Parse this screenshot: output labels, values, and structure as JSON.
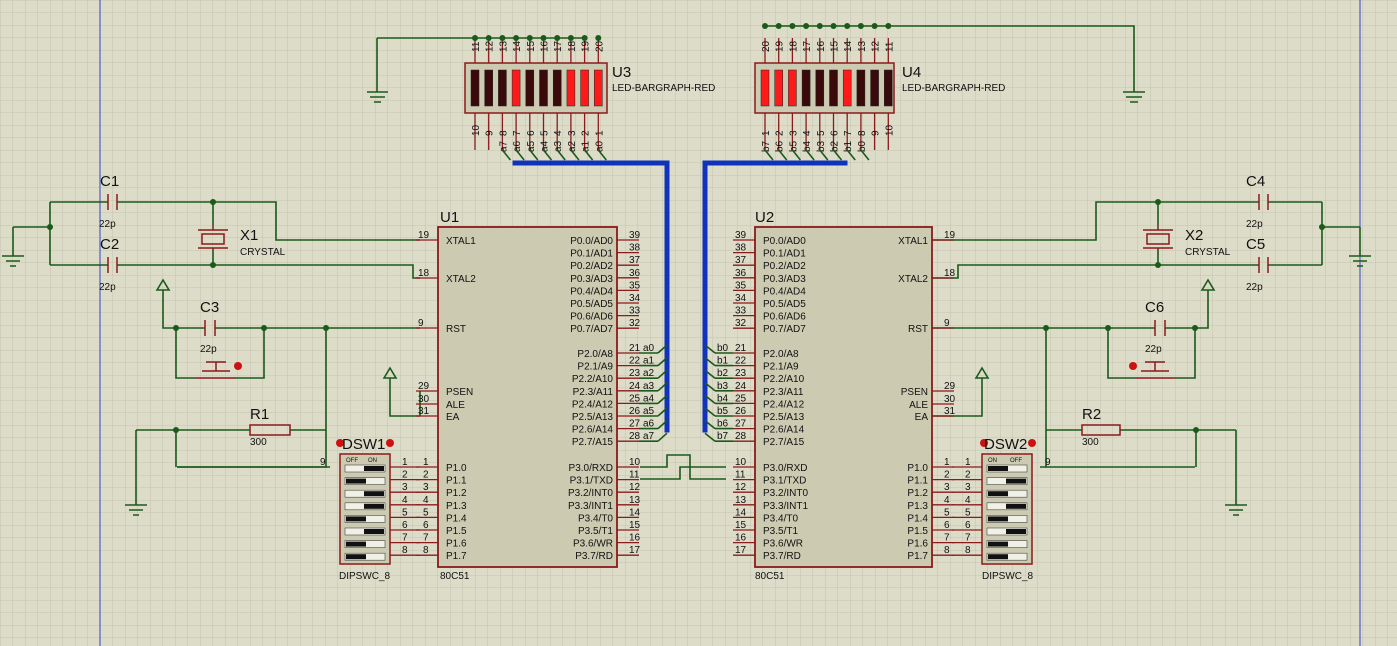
{
  "mcu": {
    "u1": {
      "ref": "U1",
      "type": "80C51"
    },
    "u2": {
      "ref": "U2",
      "type": "80C51"
    },
    "xtal1": "XTAL1",
    "xtal2": "XTAL2",
    "rst": "RST",
    "psen": "PSEN",
    "ale": "ALE",
    "ea": "EA",
    "p0": [
      [
        "P0.0/AD0",
        "39"
      ],
      [
        "P0.1/AD1",
        "38"
      ],
      [
        "P0.2/AD2",
        "37"
      ],
      [
        "P0.3/AD3",
        "36"
      ],
      [
        "P0.4/AD4",
        "35"
      ],
      [
        "P0.5/AD5",
        "34"
      ],
      [
        "P0.6/AD6",
        "33"
      ],
      [
        "P0.7/AD7",
        "32"
      ]
    ],
    "p2": [
      [
        "P2.0/A8",
        "21"
      ],
      [
        "P2.1/A9",
        "22"
      ],
      [
        "P2.2/A10",
        "23"
      ],
      [
        "P2.3/A11",
        "24"
      ],
      [
        "P2.4/A12",
        "25"
      ],
      [
        "P2.5/A13",
        "26"
      ],
      [
        "P2.6/A14",
        "27"
      ],
      [
        "P2.7/A15",
        "28"
      ]
    ],
    "p3": [
      [
        "P3.0/RXD",
        "10"
      ],
      [
        "P3.1/TXD",
        "11"
      ],
      [
        "P3.2/INT0",
        "12"
      ],
      [
        "P3.3/INT1",
        "13"
      ],
      [
        "P3.4/T0",
        "14"
      ],
      [
        "P3.5/T1",
        "15"
      ],
      [
        "P3.6/WR",
        "16"
      ],
      [
        "P3.7/RD",
        "17"
      ]
    ],
    "p1": [
      [
        "P1.0",
        "1"
      ],
      [
        "P1.1",
        "2"
      ],
      [
        "P1.2",
        "3"
      ],
      [
        "P1.3",
        "4"
      ],
      [
        "P1.4",
        "5"
      ],
      [
        "P1.5",
        "6"
      ],
      [
        "P1.6",
        "7"
      ],
      [
        "P1.7",
        "8"
      ]
    ],
    "pins": {
      "xtal1": "19",
      "xtal2": "18",
      "rst": "9",
      "psen": "29",
      "ale": "30",
      "ea": "31"
    }
  },
  "bargraph": {
    "u3": {
      "ref": "U3",
      "type": "LED-BARGRAPH-RED"
    },
    "u4": {
      "ref": "U4",
      "type": "LED-BARGRAPH-RED"
    },
    "top_pins": [
      "11",
      "12",
      "13",
      "14",
      "15",
      "16",
      "17",
      "18",
      "19",
      "20"
    ],
    "bottom_pins": [
      "10",
      "9",
      "8",
      "7",
      "6",
      "5",
      "4",
      "3",
      "2",
      "1"
    ],
    "u3_lit": [
      false,
      false,
      false,
      true,
      false,
      false,
      false,
      true,
      true,
      true
    ],
    "u4_lit": [
      true,
      true,
      true,
      false,
      false,
      false,
      true,
      false,
      false,
      false
    ]
  },
  "nets": {
    "a": [
      "a7",
      "a6",
      "a5",
      "a4",
      "a3",
      "a2",
      "a1",
      "a0"
    ],
    "b": [
      "b7",
      "b6",
      "b5",
      "b4",
      "b3",
      "b2",
      "b1",
      "b0"
    ],
    "a_p2": [
      "a0",
      "a1",
      "a2",
      "a3",
      "a4",
      "a5",
      "a6",
      "a7"
    ],
    "b_p2": [
      "b0",
      "b1",
      "b2",
      "b3",
      "b4",
      "b5",
      "b6",
      "b7"
    ]
  },
  "passives": {
    "c1": "C1",
    "c2": "C2",
    "c3": "C3",
    "c4": "C4",
    "c5": "C5",
    "c6": "C6",
    "cap": "22p",
    "x1": "X1",
    "x2": "X2",
    "crystal": "CRYSTAL",
    "r1": "R1",
    "r2": "R2",
    "r_val": "300",
    "dsw1": "DSW1",
    "dsw2": "DSW2",
    "dipsw": "DIPSWC_8",
    "on": "ON",
    "off": "OFF",
    "dsw_pin": "9",
    "dsw1_on": [
      true,
      false,
      true,
      true,
      false,
      true,
      false,
      false
    ],
    "dsw2_on": [
      true,
      false,
      true,
      false,
      true,
      false,
      true,
      true
    ]
  },
  "colors": {
    "wire": "#1a5a1a",
    "component": "#8b1a1a",
    "bus": "#1133bb",
    "led_on": "#ff1a1a",
    "led_off": "#3a0a0a",
    "chip": "#cccbb2",
    "bg": "#dcdcc9"
  }
}
